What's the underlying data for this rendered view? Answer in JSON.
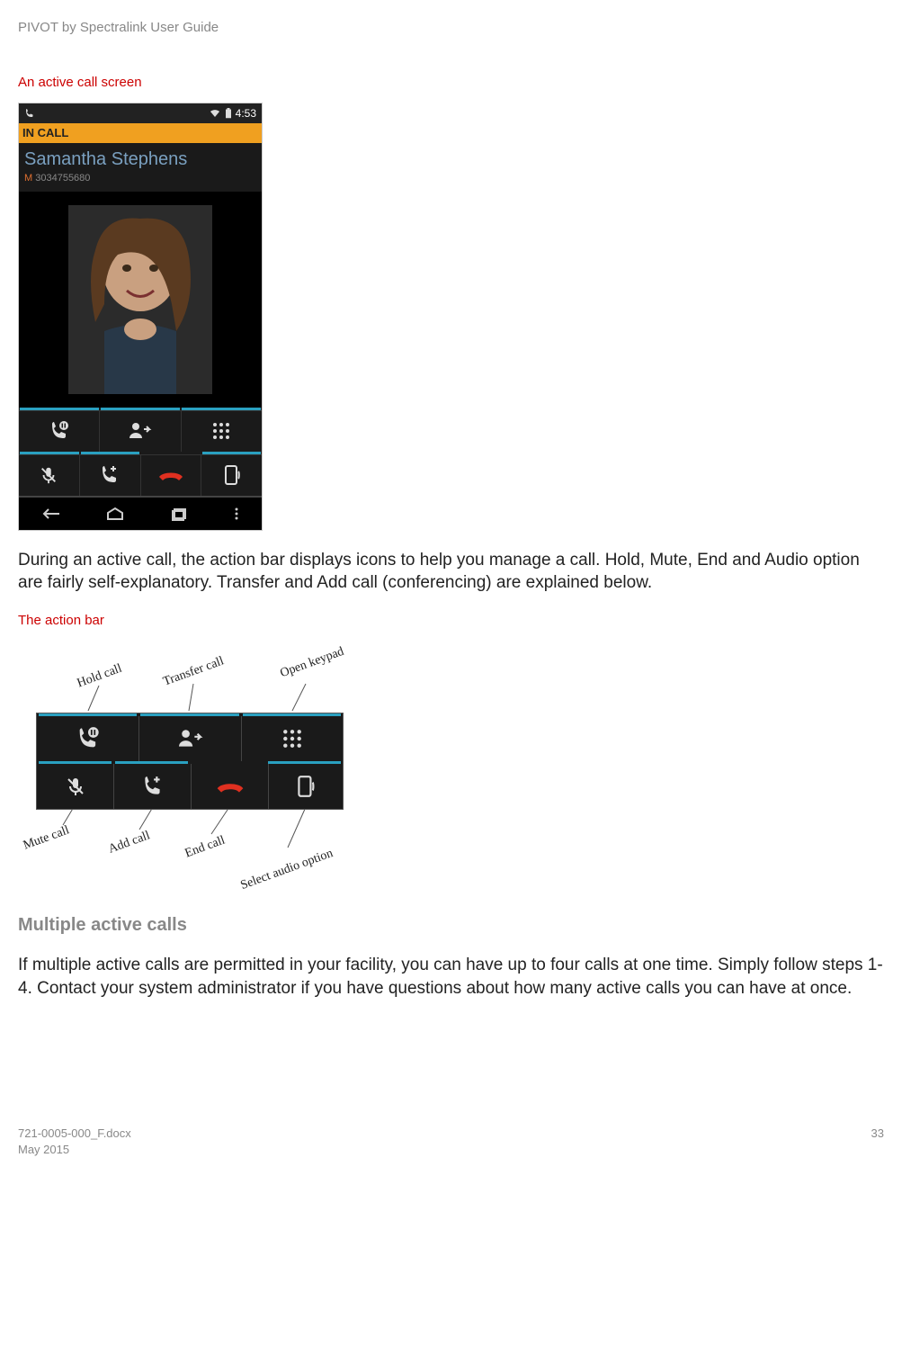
{
  "header": {
    "title": "PIVOT by Spectralink User Guide"
  },
  "caption1": "An active call screen",
  "phone": {
    "status_time": "4:53",
    "in_call": "IN CALL",
    "caller_name": "Samantha Stephens",
    "caller_prefix": "M",
    "caller_number": "3034755680"
  },
  "paragraph1": "During an active call, the action bar displays icons to help you manage a call. Hold, Mute, End and Audio option are fairly self-explanatory. Transfer and Add call (conferencing) are explained below.",
  "caption2": "The action bar",
  "labels": {
    "hold": "Hold call",
    "transfer": "Transfer call",
    "keypad": "Open keypad",
    "mute": "Mute call",
    "add": "Add call",
    "end": "End call",
    "audio": "Select audio option"
  },
  "subheading": "Multiple active calls",
  "paragraph2": "If multiple active calls are permitted in your facility, you can have up to four calls at one time. Simply follow steps 1-4. Contact your system administrator if you have questions about how many active calls you can have at once.",
  "footer": {
    "doc": "721-0005-000_F.docx",
    "date": "May 2015",
    "page": "33"
  }
}
